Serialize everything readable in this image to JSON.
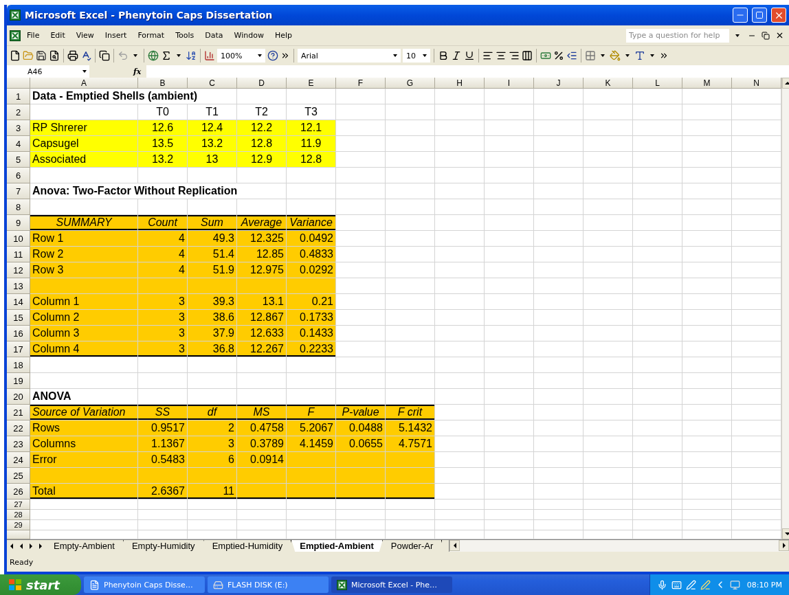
{
  "window": {
    "title": "Microsoft Excel - Phenytoin Caps Dissertation"
  },
  "menu": [
    "File",
    "Edit",
    "View",
    "Insert",
    "Format",
    "Tools",
    "Data",
    "Window",
    "Help"
  ],
  "help_box": {
    "placeholder": "Type a question for help"
  },
  "toolbar": {
    "zoom": "100%",
    "font": "Arial",
    "font_size": "10"
  },
  "formula_bar": {
    "name_box": "A46",
    "function_label": "fx"
  },
  "sheet": {
    "columns": [
      "A",
      "B",
      "C",
      "D",
      "E",
      "F",
      "G",
      "H",
      "I",
      "J",
      "K",
      "L",
      "M",
      "N"
    ],
    "rows": [
      {
        "number": "1",
        "tall": true,
        "cells": [
          {
            "text": "Data - Emptied Shells (ambient)",
            "bold": true
          }
        ]
      },
      {
        "number": "2",
        "tall": true,
        "cells": [
          {},
          {
            "text": "T0",
            "centered": true
          },
          {
            "text": "T1",
            "centered": true
          },
          {
            "text": "T2",
            "centered": true
          },
          {
            "text": "T3",
            "centered": true
          }
        ]
      },
      {
        "number": "3",
        "tall": true,
        "cells": [
          {
            "text": "RP Shrerer",
            "color": "#ffff00"
          },
          {
            "text": "12.6",
            "centered": true,
            "color": "#ffff00"
          },
          {
            "text": "12.4",
            "centered": true,
            "color": "#ffff00"
          },
          {
            "text": "12.2",
            "centered": true,
            "color": "#ffff00"
          },
          {
            "text": "12.1",
            "centered": true,
            "color": "#ffff00"
          }
        ]
      },
      {
        "number": "4",
        "tall": true,
        "cells": [
          {
            "text": "Capsugel",
            "color": "#ffff00"
          },
          {
            "text": "13.5",
            "centered": true,
            "color": "#ffff00"
          },
          {
            "text": "13.2",
            "centered": true,
            "color": "#ffff00"
          },
          {
            "text": "12.8",
            "centered": true,
            "color": "#ffff00"
          },
          {
            "text": "11.9",
            "centered": true,
            "color": "#ffff00"
          }
        ]
      },
      {
        "number": "5",
        "tall": true,
        "cells": [
          {
            "text": "Associated",
            "color": "#ffff00"
          },
          {
            "text": "13.2",
            "centered": true,
            "color": "#ffff00"
          },
          {
            "text": "13",
            "centered": true,
            "color": "#ffff00"
          },
          {
            "text": "12.9",
            "centered": true,
            "color": "#ffff00"
          },
          {
            "text": "12.8",
            "centered": true,
            "color": "#ffff00"
          }
        ]
      },
      {
        "number": "6",
        "tall": true,
        "cells": []
      },
      {
        "number": "7",
        "tall": true,
        "cells": [
          {
            "text": "Anova: Two-Factor Without Replication",
            "bold": true
          }
        ]
      },
      {
        "number": "8",
        "tall": true,
        "cells": []
      },
      {
        "number": "9",
        "tall": true,
        "cells": [
          {
            "text": "SUMMARY",
            "italic": true,
            "centered": true,
            "color": "#ffcc00",
            "rule_above": true,
            "rule_below": true
          },
          {
            "text": "Count",
            "italic": true,
            "centered": true,
            "color": "#ffcc00",
            "rule_above": true,
            "rule_below": true
          },
          {
            "text": "Sum",
            "italic": true,
            "centered": true,
            "color": "#ffcc00",
            "rule_above": true,
            "rule_below": true
          },
          {
            "text": "Average",
            "italic": true,
            "centered": true,
            "color": "#ffcc00",
            "rule_above": true,
            "rule_below": true
          },
          {
            "text": "Variance",
            "italic": true,
            "centered": true,
            "color": "#ffcc00",
            "rule_above": true,
            "rule_below": true
          }
        ]
      },
      {
        "number": "10",
        "tall": true,
        "cells": [
          {
            "text": "Row 1",
            "color": "#ffcc00"
          },
          {
            "text": "4",
            "right_aligned": true,
            "color": "#ffcc00"
          },
          {
            "text": "49.3",
            "right_aligned": true,
            "color": "#ffcc00"
          },
          {
            "text": "12.325",
            "right_aligned": true,
            "color": "#ffcc00"
          },
          {
            "text": "0.0492",
            "right_aligned": true,
            "color": "#ffcc00"
          }
        ]
      },
      {
        "number": "11",
        "tall": true,
        "cells": [
          {
            "text": "Row 2",
            "color": "#ffcc00"
          },
          {
            "text": "4",
            "right_aligned": true,
            "color": "#ffcc00"
          },
          {
            "text": "51.4",
            "right_aligned": true,
            "color": "#ffcc00"
          },
          {
            "text": "12.85",
            "right_aligned": true,
            "color": "#ffcc00"
          },
          {
            "text": "0.4833",
            "right_aligned": true,
            "color": "#ffcc00"
          }
        ]
      },
      {
        "number": "12",
        "tall": true,
        "cells": [
          {
            "text": "Row 3",
            "color": "#ffcc00"
          },
          {
            "text": "4",
            "right_aligned": true,
            "color": "#ffcc00"
          },
          {
            "text": "51.9",
            "right_aligned": true,
            "color": "#ffcc00"
          },
          {
            "text": "12.975",
            "right_aligned": true,
            "color": "#ffcc00"
          },
          {
            "text": "0.0292",
            "right_aligned": true,
            "color": "#ffcc00"
          }
        ]
      },
      {
        "number": "13",
        "tall": true,
        "cells": [
          {
            "color": "#ffcc00"
          },
          {
            "color": "#ffcc00"
          },
          {
            "color": "#ffcc00"
          },
          {
            "color": "#ffcc00"
          },
          {
            "color": "#ffcc00"
          }
        ]
      },
      {
        "number": "14",
        "tall": true,
        "cells": [
          {
            "text": "Column 1",
            "color": "#ffcc00"
          },
          {
            "text": "3",
            "right_aligned": true,
            "color": "#ffcc00"
          },
          {
            "text": "39.3",
            "right_aligned": true,
            "color": "#ffcc00"
          },
          {
            "text": "13.1",
            "right_aligned": true,
            "color": "#ffcc00"
          },
          {
            "text": "0.21",
            "right_aligned": true,
            "color": "#ffcc00"
          }
        ]
      },
      {
        "number": "15",
        "tall": true,
        "cells": [
          {
            "text": "Column 2",
            "color": "#ffcc00"
          },
          {
            "text": "3",
            "right_aligned": true,
            "color": "#ffcc00"
          },
          {
            "text": "38.6",
            "right_aligned": true,
            "color": "#ffcc00"
          },
          {
            "text": "12.867",
            "right_aligned": true,
            "color": "#ffcc00"
          },
          {
            "text": "0.1733",
            "right_aligned": true,
            "color": "#ffcc00"
          }
        ]
      },
      {
        "number": "16",
        "tall": true,
        "cells": [
          {
            "text": "Column 3",
            "color": "#ffcc00"
          },
          {
            "text": "3",
            "right_aligned": true,
            "color": "#ffcc00"
          },
          {
            "text": "37.9",
            "right_aligned": true,
            "color": "#ffcc00"
          },
          {
            "text": "12.633",
            "right_aligned": true,
            "color": "#ffcc00"
          },
          {
            "text": "0.1433",
            "right_aligned": true,
            "color": "#ffcc00"
          }
        ]
      },
      {
        "number": "17",
        "tall": true,
        "cells": [
          {
            "text": "Column 4",
            "color": "#ffcc00",
            "rule_below": true
          },
          {
            "text": "3",
            "right_aligned": true,
            "color": "#ffcc00",
            "rule_below": true
          },
          {
            "text": "36.8",
            "right_aligned": true,
            "color": "#ffcc00",
            "rule_below": true
          },
          {
            "text": "12.267",
            "right_aligned": true,
            "color": "#ffcc00",
            "rule_below": true
          },
          {
            "text": "0.2233",
            "right_aligned": true,
            "color": "#ffcc00",
            "rule_below": true
          }
        ]
      },
      {
        "number": "18",
        "tall": true,
        "cells": []
      },
      {
        "number": "19",
        "tall": true,
        "cells": []
      },
      {
        "number": "20",
        "tall": true,
        "cells": [
          {
            "text": "ANOVA",
            "bold": true
          }
        ]
      },
      {
        "number": "21",
        "tall": true,
        "cells": [
          {
            "text": "Source of Variation",
            "italic": true,
            "color": "#ffcc00",
            "rule_above": true,
            "rule_below": true
          },
          {
            "text": "SS",
            "italic": true,
            "centered": true,
            "color": "#ffcc00",
            "rule_above": true,
            "rule_below": true
          },
          {
            "text": "df",
            "italic": true,
            "centered": true,
            "color": "#ffcc00",
            "rule_above": true,
            "rule_below": true
          },
          {
            "text": "MS",
            "italic": true,
            "centered": true,
            "color": "#ffcc00",
            "rule_above": true,
            "rule_below": true
          },
          {
            "text": "F",
            "italic": true,
            "centered": true,
            "color": "#ffcc00",
            "rule_above": true,
            "rule_below": true
          },
          {
            "text": "P-value",
            "italic": true,
            "centered": true,
            "color": "#ffcc00",
            "rule_above": true,
            "rule_below": true
          },
          {
            "text": "F crit",
            "italic": true,
            "centered": true,
            "color": "#ffcc00",
            "rule_above": true,
            "rule_below": true
          }
        ]
      },
      {
        "number": "22",
        "tall": true,
        "cells": [
          {
            "text": "Rows",
            "color": "#ffcc00"
          },
          {
            "text": "0.9517",
            "right_aligned": true,
            "color": "#ffcc00"
          },
          {
            "text": "2",
            "right_aligned": true,
            "color": "#ffcc00"
          },
          {
            "text": "0.4758",
            "right_aligned": true,
            "color": "#ffcc00"
          },
          {
            "text": "5.2067",
            "right_aligned": true,
            "color": "#ffcc00"
          },
          {
            "text": "0.0488",
            "right_aligned": true,
            "color": "#ffcc00"
          },
          {
            "text": "5.1432",
            "right_aligned": true,
            "color": "#ffcc00"
          }
        ]
      },
      {
        "number": "23",
        "tall": true,
        "cells": [
          {
            "text": "Columns",
            "color": "#ffcc00"
          },
          {
            "text": "1.1367",
            "right_aligned": true,
            "color": "#ffcc00"
          },
          {
            "text": "3",
            "right_aligned": true,
            "color": "#ffcc00"
          },
          {
            "text": "0.3789",
            "right_aligned": true,
            "color": "#ffcc00"
          },
          {
            "text": "4.1459",
            "right_aligned": true,
            "color": "#ffcc00"
          },
          {
            "text": "0.0655",
            "right_aligned": true,
            "color": "#ffcc00"
          },
          {
            "text": "4.7571",
            "right_aligned": true,
            "color": "#ffcc00"
          }
        ]
      },
      {
        "number": "24",
        "tall": true,
        "cells": [
          {
            "text": "Error",
            "color": "#ffcc00"
          },
          {
            "text": "0.5483",
            "right_aligned": true,
            "color": "#ffcc00"
          },
          {
            "text": "6",
            "right_aligned": true,
            "color": "#ffcc00"
          },
          {
            "text": "0.0914",
            "right_aligned": true,
            "color": "#ffcc00"
          },
          {
            "color": "#ffcc00"
          },
          {
            "color": "#ffcc00"
          },
          {
            "color": "#ffcc00"
          }
        ]
      },
      {
        "number": "25",
        "tall": true,
        "cells": [
          {
            "color": "#ffcc00"
          },
          {
            "color": "#ffcc00"
          },
          {
            "color": "#ffcc00"
          },
          {
            "color": "#ffcc00"
          },
          {
            "color": "#ffcc00"
          },
          {
            "color": "#ffcc00"
          },
          {
            "color": "#ffcc00"
          }
        ]
      },
      {
        "number": "26",
        "tall": true,
        "cells": [
          {
            "text": "Total",
            "color": "#ffcc00",
            "rule_below": true
          },
          {
            "text": "2.6367",
            "right_aligned": true,
            "color": "#ffcc00",
            "rule_below": true
          },
          {
            "text": "11",
            "right_aligned": true,
            "color": "#ffcc00",
            "rule_below": true
          },
          {
            "color": "#ffcc00",
            "rule_below": true
          },
          {
            "color": "#ffcc00",
            "rule_below": true
          },
          {
            "color": "#ffcc00",
            "rule_below": true
          },
          {
            "color": "#ffcc00",
            "rule_below": true
          }
        ]
      },
      {
        "number": "27",
        "tall": false,
        "cells": []
      },
      {
        "number": "28",
        "tall": false,
        "cells": []
      },
      {
        "number": "29",
        "tall": false,
        "cells": []
      }
    ]
  },
  "sheet_tabs": [
    {
      "label": "Empty-Ambient",
      "selected": false
    },
    {
      "label": "Empty-Humidity",
      "selected": false
    },
    {
      "label": "Emptied-Humidity",
      "selected": false
    },
    {
      "label": "Emptied-Ambient",
      "selected": true
    },
    {
      "label": "Powder-Ar",
      "selected": false
    }
  ],
  "status_bar": {
    "text": "Ready"
  },
  "taskbar": {
    "start": "start",
    "tasks": [
      {
        "label": "Phenytoin Caps Disse…",
        "kind": "word",
        "selected": false
      },
      {
        "label": "FLASH DISK (E:)",
        "kind": "drive",
        "selected": false
      },
      {
        "label": "Microsoft Excel - Phe…",
        "kind": "excel",
        "selected": true
      }
    ],
    "clock": "08:10 PM"
  }
}
